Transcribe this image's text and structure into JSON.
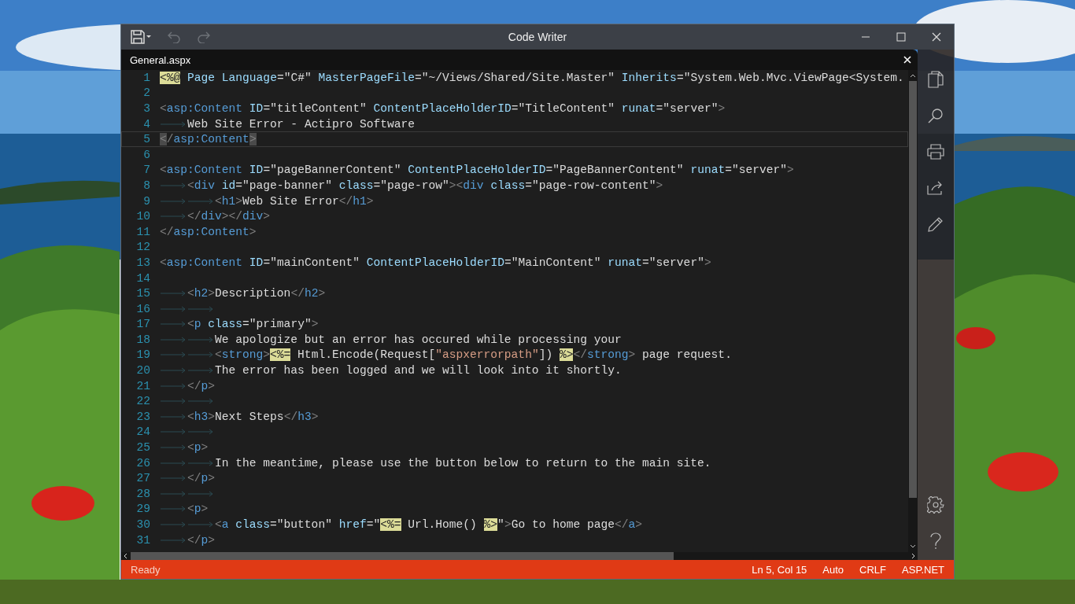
{
  "window": {
    "title": "Code Writer"
  },
  "toolbar": [
    {
      "kind": "save",
      "disabled": false
    },
    {
      "kind": "undo",
      "disabled": true
    },
    {
      "kind": "redo",
      "disabled": true
    }
  ],
  "tab": {
    "label": "General.aspx"
  },
  "lines": [
    {
      "number": "1",
      "current": false,
      "tokens": [
        {
          "kind": "directive",
          "text": "<%@"
        },
        {
          "kind": "attr",
          "text": " Page Language"
        },
        {
          "kind": "plain",
          "text": "=\"C#\""
        },
        {
          "kind": "attr",
          "text": " MasterPageFile"
        },
        {
          "kind": "plain",
          "text": "=\"~/Views/Shared/Site.Master\""
        },
        {
          "kind": "attr",
          "text": " Inherits"
        },
        {
          "kind": "plain",
          "text": "=\"System.Web.Mvc.ViewPage<System."
        }
      ]
    },
    {
      "number": "2",
      "current": false
    },
    {
      "number": "3",
      "current": false,
      "tokens": [
        {
          "kind": "delim",
          "text": "<"
        },
        {
          "kind": "tag",
          "text": "asp:Content"
        },
        {
          "kind": "attr",
          "text": " ID"
        },
        {
          "kind": "plain",
          "text": "=\"titleContent\""
        },
        {
          "kind": "attr",
          "text": " ContentPlaceHolderID"
        },
        {
          "kind": "plain",
          "text": "=\"TitleContent\""
        },
        {
          "kind": "attr",
          "text": " runat"
        },
        {
          "kind": "plain",
          "text": "=\"server\""
        },
        {
          "kind": "delim",
          "text": ">"
        }
      ]
    },
    {
      "number": "4",
      "current": false,
      "tokens": [
        {
          "kind": "tab"
        },
        {
          "kind": "plain",
          "text": "Web Site Error - Actipro Software"
        }
      ]
    },
    {
      "number": "5",
      "current": true,
      "tokens": [
        {
          "kind": "match",
          "text": "<"
        },
        {
          "kind": "delim",
          "text": "/"
        },
        {
          "kind": "tag",
          "text": "asp:Content"
        },
        {
          "kind": "match",
          "text": ">"
        }
      ]
    },
    {
      "number": "6",
      "current": false
    },
    {
      "number": "7",
      "current": false,
      "tokens": [
        {
          "kind": "delim",
          "text": "<"
        },
        {
          "kind": "tag",
          "text": "asp:Content"
        },
        {
          "kind": "attr",
          "text": " ID"
        },
        {
          "kind": "plain",
          "text": "=\"pageBannerContent\""
        },
        {
          "kind": "attr",
          "text": " ContentPlaceHolderID"
        },
        {
          "kind": "plain",
          "text": "=\"PageBannerContent\""
        },
        {
          "kind": "attr",
          "text": " runat"
        },
        {
          "kind": "plain",
          "text": "=\"server\""
        },
        {
          "kind": "delim",
          "text": ">"
        }
      ]
    },
    {
      "number": "8",
      "current": false,
      "tokens": [
        {
          "kind": "tab"
        },
        {
          "kind": "delim",
          "text": "<"
        },
        {
          "kind": "tag",
          "text": "div"
        },
        {
          "kind": "attr",
          "text": " id"
        },
        {
          "kind": "plain",
          "text": "=\"page-banner\""
        },
        {
          "kind": "attr",
          "text": " class"
        },
        {
          "kind": "plain",
          "text": "=\"page-row\""
        },
        {
          "kind": "delim",
          "text": "><"
        },
        {
          "kind": "tag",
          "text": "div"
        },
        {
          "kind": "attr",
          "text": " class"
        },
        {
          "kind": "plain",
          "text": "=\"page-row-content\""
        },
        {
          "kind": "delim",
          "text": ">"
        }
      ]
    },
    {
      "number": "9",
      "current": false,
      "tokens": [
        {
          "kind": "tab"
        },
        {
          "kind": "tab"
        },
        {
          "kind": "delim",
          "text": "<"
        },
        {
          "kind": "tag",
          "text": "h1"
        },
        {
          "kind": "delim",
          "text": ">"
        },
        {
          "kind": "plain",
          "text": "Web Site Error"
        },
        {
          "kind": "delim",
          "text": "</"
        },
        {
          "kind": "tag",
          "text": "h1"
        },
        {
          "kind": "delim",
          "text": ">"
        }
      ]
    },
    {
      "number": "10",
      "current": false,
      "tokens": [
        {
          "kind": "tab"
        },
        {
          "kind": "delim",
          "text": "</"
        },
        {
          "kind": "tag",
          "text": "div"
        },
        {
          "kind": "delim",
          "text": "></"
        },
        {
          "kind": "tag",
          "text": "div"
        },
        {
          "kind": "delim",
          "text": ">"
        }
      ]
    },
    {
      "number": "11",
      "current": false,
      "tokens": [
        {
          "kind": "delim",
          "text": "</"
        },
        {
          "kind": "tag",
          "text": "asp:Content"
        },
        {
          "kind": "delim",
          "text": ">"
        }
      ]
    },
    {
      "number": "12",
      "current": false
    },
    {
      "number": "13",
      "current": false,
      "tokens": [
        {
          "kind": "delim",
          "text": "<"
        },
        {
          "kind": "tag",
          "text": "asp:Content"
        },
        {
          "kind": "attr",
          "text": " ID"
        },
        {
          "kind": "plain",
          "text": "=\"mainContent\""
        },
        {
          "kind": "attr",
          "text": " ContentPlaceHolderID"
        },
        {
          "kind": "plain",
          "text": "=\"MainContent\""
        },
        {
          "kind": "attr",
          "text": " runat"
        },
        {
          "kind": "plain",
          "text": "=\"server\""
        },
        {
          "kind": "delim",
          "text": ">"
        }
      ]
    },
    {
      "number": "14",
      "current": false
    },
    {
      "number": "15",
      "current": false,
      "tokens": [
        {
          "kind": "tab"
        },
        {
          "kind": "delim",
          "text": "<"
        },
        {
          "kind": "tag",
          "text": "h2"
        },
        {
          "kind": "delim",
          "text": ">"
        },
        {
          "kind": "plain",
          "text": "Description"
        },
        {
          "kind": "delim",
          "text": "</"
        },
        {
          "kind": "tag",
          "text": "h2"
        },
        {
          "kind": "delim",
          "text": ">"
        }
      ]
    },
    {
      "number": "16",
      "current": false,
      "tokens": [
        {
          "kind": "tab"
        },
        {
          "kind": "tab"
        }
      ]
    },
    {
      "number": "17",
      "current": false,
      "tokens": [
        {
          "kind": "tab"
        },
        {
          "kind": "delim",
          "text": "<"
        },
        {
          "kind": "tag",
          "text": "p"
        },
        {
          "kind": "attr",
          "text": " class"
        },
        {
          "kind": "plain",
          "text": "=\"primary\""
        },
        {
          "kind": "delim",
          "text": ">"
        }
      ]
    },
    {
      "number": "18",
      "current": false,
      "tokens": [
        {
          "kind": "tab"
        },
        {
          "kind": "tab"
        },
        {
          "kind": "plain",
          "text": "We apologize but an error has occured while processing your"
        }
      ]
    },
    {
      "number": "19",
      "current": false,
      "tokens": [
        {
          "kind": "tab"
        },
        {
          "kind": "tab"
        },
        {
          "kind": "delim",
          "text": "<"
        },
        {
          "kind": "tag",
          "text": "strong"
        },
        {
          "kind": "delim",
          "text": ">"
        },
        {
          "kind": "directive",
          "text": "<%="
        },
        {
          "kind": "plain",
          "text": " Html.Encode(Request["
        },
        {
          "kind": "string",
          "text": "\"aspxerrorpath\""
        },
        {
          "kind": "plain",
          "text": "]) "
        },
        {
          "kind": "directive",
          "text": "%>"
        },
        {
          "kind": "delim",
          "text": "</"
        },
        {
          "kind": "tag",
          "text": "strong"
        },
        {
          "kind": "delim",
          "text": ">"
        },
        {
          "kind": "plain",
          "text": " page request."
        }
      ]
    },
    {
      "number": "20",
      "current": false,
      "tokens": [
        {
          "kind": "tab"
        },
        {
          "kind": "tab"
        },
        {
          "kind": "plain",
          "text": "The error has been logged and we will look into it shortly."
        }
      ]
    },
    {
      "number": "21",
      "current": false,
      "tokens": [
        {
          "kind": "tab"
        },
        {
          "kind": "delim",
          "text": "</"
        },
        {
          "kind": "tag",
          "text": "p"
        },
        {
          "kind": "delim",
          "text": ">"
        }
      ]
    },
    {
      "number": "22",
      "current": false,
      "tokens": [
        {
          "kind": "tab"
        },
        {
          "kind": "tab"
        }
      ]
    },
    {
      "number": "23",
      "current": false,
      "tokens": [
        {
          "kind": "tab"
        },
        {
          "kind": "delim",
          "text": "<"
        },
        {
          "kind": "tag",
          "text": "h3"
        },
        {
          "kind": "delim",
          "text": ">"
        },
        {
          "kind": "plain",
          "text": "Next Steps"
        },
        {
          "kind": "delim",
          "text": "</"
        },
        {
          "kind": "tag",
          "text": "h3"
        },
        {
          "kind": "delim",
          "text": ">"
        }
      ]
    },
    {
      "number": "24",
      "current": false,
      "tokens": [
        {
          "kind": "tab"
        },
        {
          "kind": "tab"
        }
      ]
    },
    {
      "number": "25",
      "current": false,
      "tokens": [
        {
          "kind": "tab"
        },
        {
          "kind": "delim",
          "text": "<"
        },
        {
          "kind": "tag",
          "text": "p"
        },
        {
          "kind": "delim",
          "text": ">"
        }
      ]
    },
    {
      "number": "26",
      "current": false,
      "tokens": [
        {
          "kind": "tab"
        },
        {
          "kind": "tab"
        },
        {
          "kind": "plain",
          "text": "In the meantime, please use the button below to return to the main site."
        }
      ]
    },
    {
      "number": "27",
      "current": false,
      "tokens": [
        {
          "kind": "tab"
        },
        {
          "kind": "delim",
          "text": "</"
        },
        {
          "kind": "tag",
          "text": "p"
        },
        {
          "kind": "delim",
          "text": ">"
        }
      ]
    },
    {
      "number": "28",
      "current": false,
      "tokens": [
        {
          "kind": "tab"
        },
        {
          "kind": "tab"
        }
      ]
    },
    {
      "number": "29",
      "current": false,
      "tokens": [
        {
          "kind": "tab"
        },
        {
          "kind": "delim",
          "text": "<"
        },
        {
          "kind": "tag",
          "text": "p"
        },
        {
          "kind": "delim",
          "text": ">"
        }
      ]
    },
    {
      "number": "30",
      "current": false,
      "tokens": [
        {
          "kind": "tab"
        },
        {
          "kind": "tab"
        },
        {
          "kind": "delim",
          "text": "<"
        },
        {
          "kind": "tag",
          "text": "a"
        },
        {
          "kind": "attr",
          "text": " class"
        },
        {
          "kind": "plain",
          "text": "=\"button\""
        },
        {
          "kind": "attr",
          "text": " href"
        },
        {
          "kind": "plain",
          "text": "=\""
        },
        {
          "kind": "directive",
          "text": "<%="
        },
        {
          "kind": "plain",
          "text": " Url.Home() "
        },
        {
          "kind": "directive",
          "text": "%>"
        },
        {
          "kind": "plain",
          "text": "\""
        },
        {
          "kind": "delim",
          "text": ">"
        },
        {
          "kind": "plain",
          "text": "Go to home page"
        },
        {
          "kind": "delim",
          "text": "</"
        },
        {
          "kind": "tag",
          "text": "a"
        },
        {
          "kind": "delim",
          "text": ">"
        }
      ]
    },
    {
      "number": "31",
      "current": false,
      "tokens": [
        {
          "kind": "tab"
        },
        {
          "kind": "delim",
          "text": "</"
        },
        {
          "kind": "tag",
          "text": "p"
        },
        {
          "kind": "delim",
          "text": ">"
        }
      ]
    }
  ],
  "sidebar": [
    {
      "kind": "documents"
    },
    {
      "kind": "search"
    },
    {
      "kind": "print"
    },
    {
      "kind": "share"
    },
    {
      "kind": "edit"
    },
    {
      "kind": "settings"
    },
    {
      "kind": "help"
    }
  ],
  "status_bar": {
    "message": "Ready",
    "items": [
      "Ln 5, Col 15",
      "Auto",
      "CRLF",
      "ASP.NET"
    ]
  }
}
